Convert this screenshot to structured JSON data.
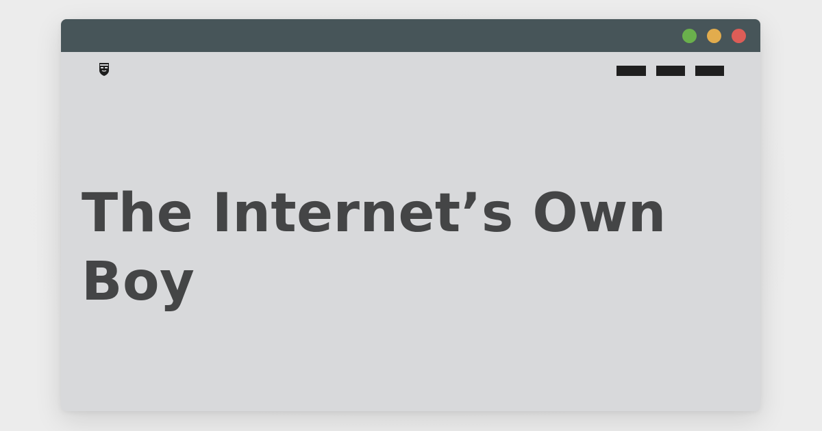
{
  "window": {
    "controls": [
      {
        "name": "green",
        "color": "#6ab04c"
      },
      {
        "name": "yellow",
        "color": "#e2ac4d"
      },
      {
        "name": "red",
        "color": "#dd5d57"
      }
    ],
    "titlebar_color": "#475559",
    "background_color": "#d8d9db"
  },
  "header": {
    "logo_icon": "masked-face-shield-icon",
    "nav_items": [
      "",
      "",
      ""
    ]
  },
  "main": {
    "title": "The Internet’s Own Boy"
  }
}
